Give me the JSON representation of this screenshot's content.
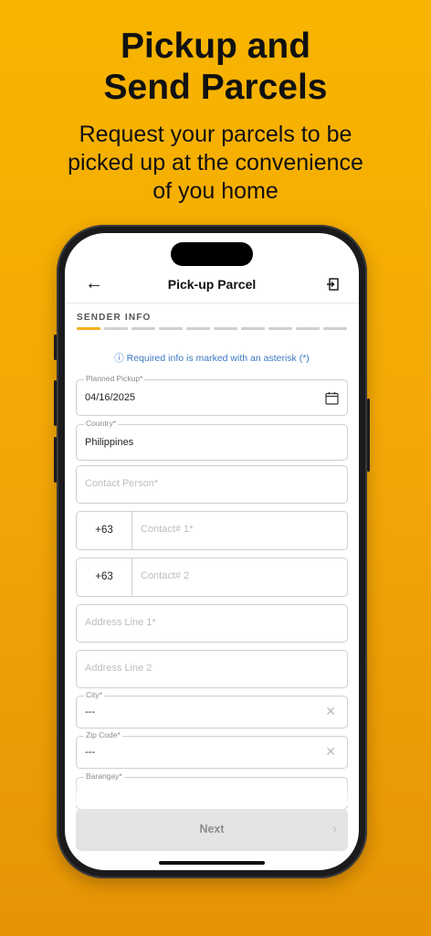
{
  "promo": {
    "headline_line1": "Pickup and",
    "headline_line2": "Send Parcels",
    "sub_line1": "Request your parcels to be",
    "sub_line2": "picked up at the convenience",
    "sub_line3": "of you home"
  },
  "app": {
    "title": "Pick-up Parcel",
    "back_icon": "←",
    "step_label": "SENDER INFO",
    "steps_total": 10,
    "steps_active": 1,
    "info_text": "ⓘ Required info is marked with an asterisk (*)",
    "colors": {
      "accent": "#f2b01e",
      "info": "#3b78c4",
      "background": "#f8b500"
    }
  },
  "form": {
    "pickup": {
      "label": "Planned Pickup*",
      "value": "04/16/2025"
    },
    "country": {
      "label": "Country*",
      "value": "Philippines"
    },
    "contact_person": {
      "placeholder": "Contact Person*"
    },
    "contact1": {
      "code": "+63",
      "placeholder": "Contact# 1*"
    },
    "contact2": {
      "code": "+63",
      "placeholder": "Contact# 2"
    },
    "address1": {
      "placeholder": "Address Line 1*"
    },
    "address2": {
      "placeholder": "Address Line 2"
    },
    "city": {
      "label": "City*",
      "value": "---"
    },
    "zip": {
      "label": "Zip Code*",
      "value": "---"
    },
    "barangay": {
      "label": "Barangay*"
    }
  },
  "footer": {
    "next_label": "Next",
    "next_chevron": "›"
  }
}
